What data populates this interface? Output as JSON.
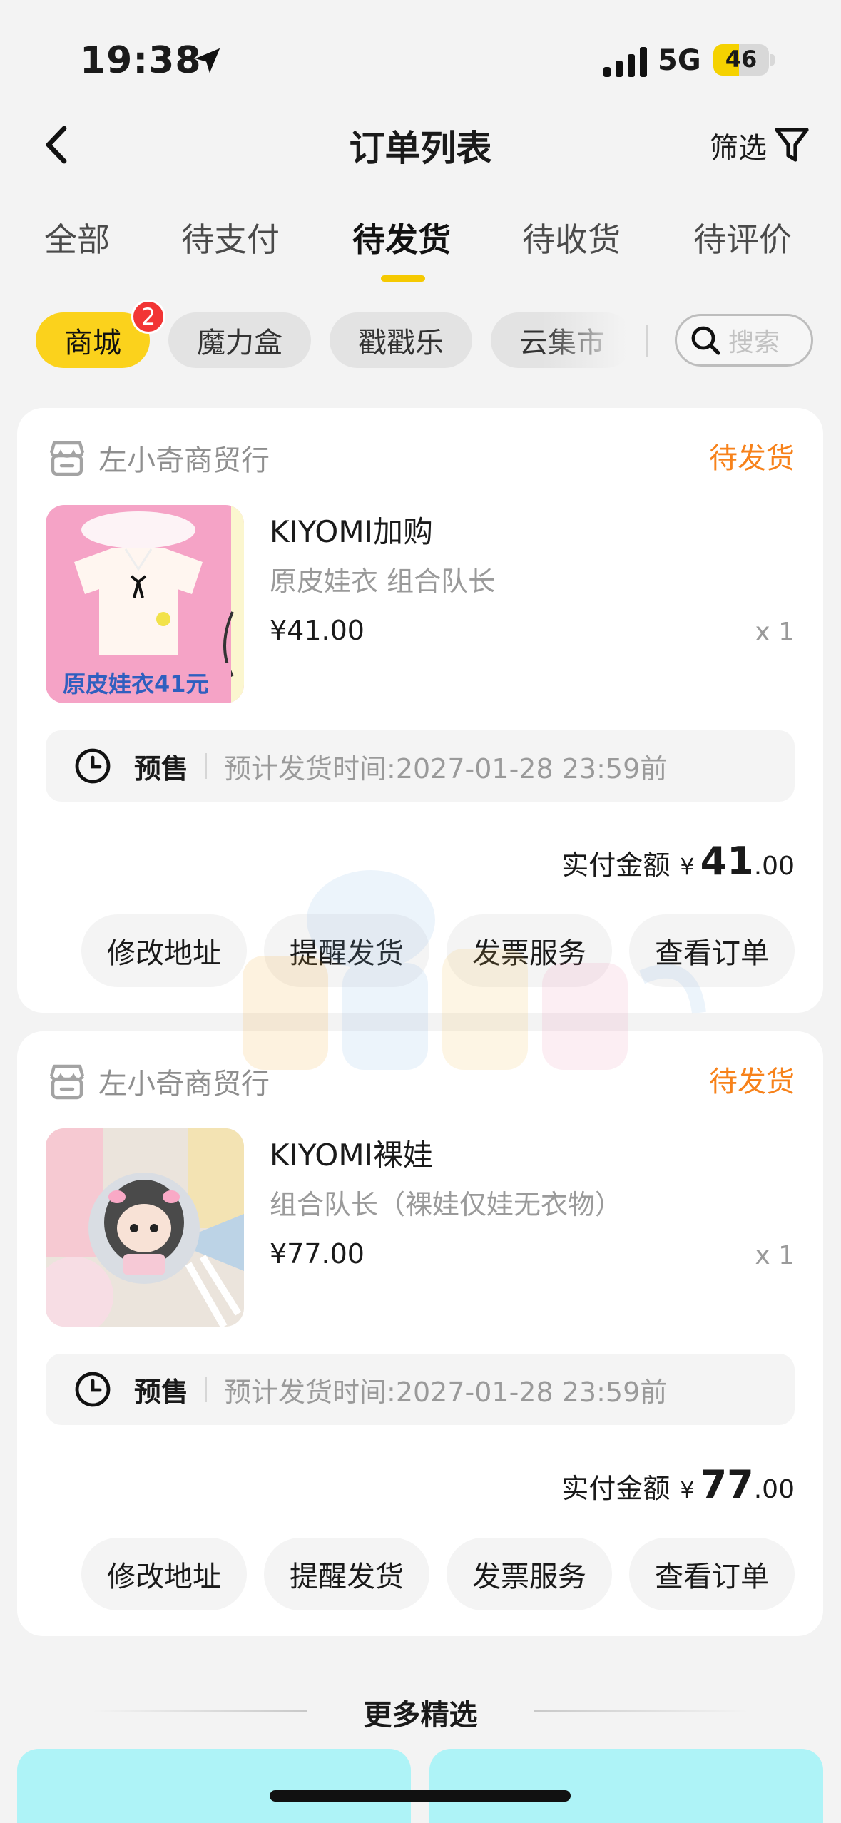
{
  "status_bar": {
    "time": "19:38",
    "network": "5G",
    "battery": "46",
    "battery_level": 0.46
  },
  "nav": {
    "title": "订单列表",
    "filter_label": "筛选"
  },
  "tabs": [
    {
      "label": "全部"
    },
    {
      "label": "待支付"
    },
    {
      "label": "待发货",
      "active": true
    },
    {
      "label": "待收货"
    },
    {
      "label": "待评价"
    }
  ],
  "chips": [
    {
      "label": "商城",
      "badge": "2",
      "active": true
    },
    {
      "label": "魔力盒"
    },
    {
      "label": "戳戳乐"
    },
    {
      "label": "云集市"
    }
  ],
  "search": {
    "placeholder": "搜索"
  },
  "orders": [
    {
      "shop": "左小奇商贸行",
      "status": "待发货",
      "title": "KIYOMI加购",
      "spec": "原皮娃衣 组合队长",
      "price": "¥41.00",
      "qty": "x 1",
      "image_caption": "原皮娃衣41元",
      "presale_label": "预售",
      "ship_time": "预计发货时间:2027-01-28 23:59前",
      "paid_label": "实付金额",
      "paid_currency": "¥",
      "paid_int": "41",
      "paid_dec": ".00",
      "actions": [
        "修改地址",
        "提醒发货",
        "发票服务",
        "查看订单"
      ]
    },
    {
      "shop": "左小奇商贸行",
      "status": "待发货",
      "title": "KIYOMI裸娃",
      "spec": "组合队长（裸娃仅娃无衣物）",
      "price": "¥77.00",
      "qty": "x 1",
      "presale_label": "预售",
      "ship_time": "预计发货时间:2027-01-28 23:59前",
      "paid_label": "实付金额",
      "paid_currency": "¥",
      "paid_int": "77",
      "paid_dec": ".00",
      "actions": [
        "修改地址",
        "提醒发货",
        "发票服务",
        "查看订单"
      ]
    }
  ],
  "more": {
    "title": "更多精选"
  },
  "colors": {
    "accent": "#fbd21c",
    "status_orange": "#f7821b",
    "badge_red": "#f23535",
    "recommend_cyan": "#aef3f7"
  },
  "icons": [
    "location-arrow-icon",
    "signal-icon",
    "back-chevron-icon",
    "filter-funnel-icon",
    "search-icon",
    "shop-icon",
    "clock-icon"
  ]
}
